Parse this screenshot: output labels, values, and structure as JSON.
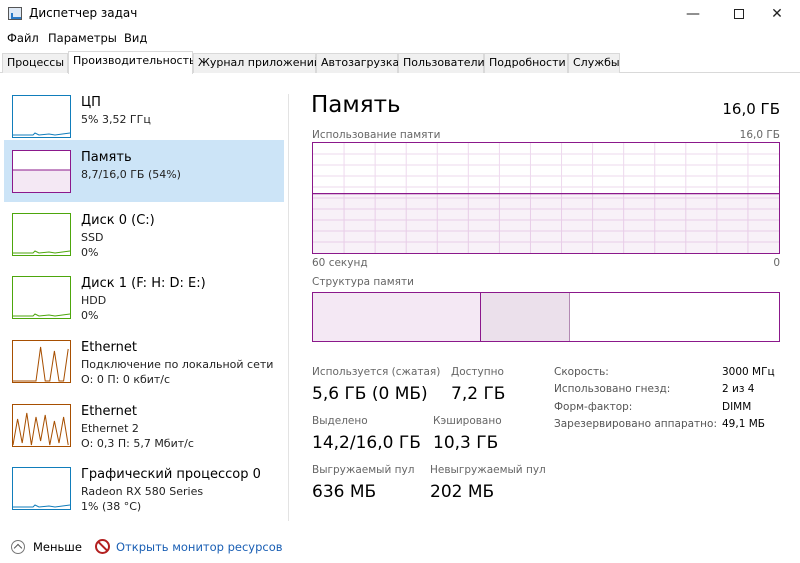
{
  "window": {
    "title": "Диспетчер задач",
    "minimize": "—",
    "close": "✕"
  },
  "menu": [
    "Файл",
    "Параметры",
    "Вид"
  ],
  "tabs": [
    "Процессы",
    "Производительность",
    "Журнал приложений",
    "Автозагрузка",
    "Пользователи",
    "Подробности",
    "Службы"
  ],
  "active_tab": "Производительность",
  "sidebar": [
    {
      "title": "ЦП",
      "sub1": "5%  3,52 ГГц",
      "sub2": "",
      "color": "#117dbb",
      "icon": "cpu-graph"
    },
    {
      "title": "Память",
      "sub1": "8,7/16,0 ГБ (54%)",
      "sub2": "",
      "color": "#8b188b",
      "icon": "memory-graph",
      "selected": true
    },
    {
      "title": "Диск 0 (C:)",
      "sub1": "SSD",
      "sub2": "0%",
      "color": "#4da60c",
      "icon": "disk-graph"
    },
    {
      "title": "Диск 1 (F: H: D: E:)",
      "sub1": "HDD",
      "sub2": "0%",
      "color": "#4da60c",
      "icon": "disk-graph"
    },
    {
      "title": "Ethernet",
      "sub1": "Подключение по локальной сети",
      "sub2": "О: 0 П: 0 кбит/с",
      "color": "#a74f01",
      "icon": "network-graph"
    },
    {
      "title": "Ethernet",
      "sub1": "Ethernet 2",
      "sub2": "О: 0,3 П: 5,7 Мбит/с",
      "color": "#a74f01",
      "icon": "network-graph"
    },
    {
      "title": "Графический процессор 0",
      "sub1": "Radeon RX 580 Series",
      "sub2": "1% (38 °C)",
      "color": "#117dbb",
      "icon": "gpu-graph"
    }
  ],
  "main": {
    "title": "Память",
    "total": "16,0 ГБ",
    "usage_label": "Использование памяти",
    "usage_max": "16,0 ГБ",
    "time_label": "60 секунд",
    "time_end": "0",
    "usage_percent": 54,
    "structure_label": "Структура памяти",
    "in_use_percent": 36,
    "modified_percent": 19
  },
  "stats": {
    "in_use_label": "Используется (сжатая)",
    "in_use_value": "5,6 ГБ (0 МБ)",
    "available_label": "Доступно",
    "available_value": "7,2 ГБ",
    "committed_label": "Выделено",
    "committed_value": "14,2/16,0 ГБ",
    "cached_label": "Кэшировано",
    "cached_value": "10,3 ГБ",
    "paged_label": "Выгружаемый пул",
    "paged_value": "636 МБ",
    "nonpaged_label": "Невыгружаемый пул",
    "nonpaged_value": "202 МБ"
  },
  "details": [
    {
      "label": "Скорость:",
      "value": "3000 МГц"
    },
    {
      "label": "Использовано гнезд:",
      "value": "2 из 4"
    },
    {
      "label": "Форм-фактор:",
      "value": "DIMM"
    },
    {
      "label": "Зарезервировано аппаратно:",
      "value": "49,1 МБ"
    }
  ],
  "footer": {
    "less": "Меньше",
    "resource_monitor": "Открыть монитор ресурсов"
  }
}
